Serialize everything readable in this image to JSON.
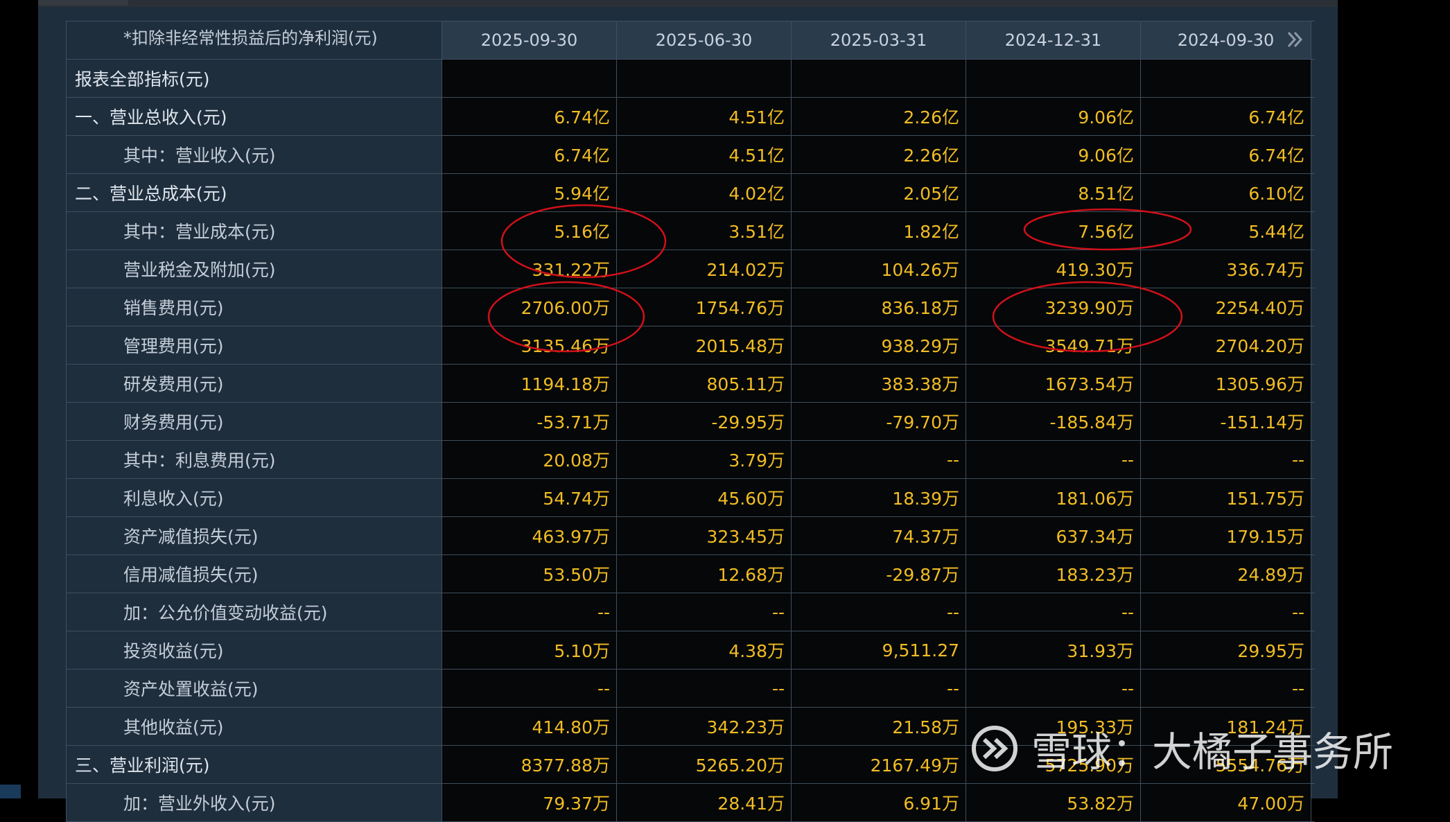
{
  "table": {
    "header_label": "*扣除非经常性损益后的净利润(元)",
    "columns": [
      "2025-09-30",
      "2025-06-30",
      "2025-03-31",
      "2024-12-31",
      "2024-09-30"
    ],
    "rows": [
      {
        "label": "报表全部指标(元)",
        "indent": false,
        "values": [
          "",
          "",
          "",
          "",
          ""
        ]
      },
      {
        "label": "一、营业总收入(元)",
        "indent": false,
        "values": [
          "6.74亿",
          "4.51亿",
          "2.26亿",
          "9.06亿",
          "6.74亿"
        ]
      },
      {
        "label": "其中：营业收入(元)",
        "indent": true,
        "values": [
          "6.74亿",
          "4.51亿",
          "2.26亿",
          "9.06亿",
          "6.74亿"
        ]
      },
      {
        "label": "二、营业总成本(元)",
        "indent": false,
        "values": [
          "5.94亿",
          "4.02亿",
          "2.05亿",
          "8.51亿",
          "6.10亿"
        ]
      },
      {
        "label": "其中：营业成本(元)",
        "indent": true,
        "values": [
          "5.16亿",
          "3.51亿",
          "1.82亿",
          "7.56亿",
          "5.44亿"
        ]
      },
      {
        "label": "营业税金及附加(元)",
        "indent": true,
        "values": [
          "331.22万",
          "214.02万",
          "104.26万",
          "419.30万",
          "336.74万"
        ]
      },
      {
        "label": "销售费用(元)",
        "indent": true,
        "values": [
          "2706.00万",
          "1754.76万",
          "836.18万",
          "3239.90万",
          "2254.40万"
        ]
      },
      {
        "label": "管理费用(元)",
        "indent": true,
        "values": [
          "3135.46万",
          "2015.48万",
          "938.29万",
          "3549.71万",
          "2704.20万"
        ]
      },
      {
        "label": "研发费用(元)",
        "indent": true,
        "values": [
          "1194.18万",
          "805.11万",
          "383.38万",
          "1673.54万",
          "1305.96万"
        ]
      },
      {
        "label": "财务费用(元)",
        "indent": true,
        "values": [
          "-53.71万",
          "-29.95万",
          "-79.70万",
          "-185.84万",
          "-151.14万"
        ]
      },
      {
        "label": "其中：利息费用(元)",
        "indent": true,
        "values": [
          "20.08万",
          "3.79万",
          "--",
          "--",
          "--"
        ]
      },
      {
        "label": "利息收入(元)",
        "indent": true,
        "values": [
          "54.74万",
          "45.60万",
          "18.39万",
          "181.06万",
          "151.75万"
        ]
      },
      {
        "label": "资产减值损失(元)",
        "indent": true,
        "values": [
          "463.97万",
          "323.45万",
          "74.37万",
          "637.34万",
          "179.15万"
        ]
      },
      {
        "label": "信用减值损失(元)",
        "indent": true,
        "values": [
          "53.50万",
          "12.68万",
          "-29.87万",
          "183.23万",
          "24.89万"
        ]
      },
      {
        "label": "加：公允价值变动收益(元)",
        "indent": true,
        "values": [
          "--",
          "--",
          "--",
          "--",
          "--"
        ]
      },
      {
        "label": "投资收益(元)",
        "indent": true,
        "values": [
          "5.10万",
          "4.38万",
          "9,511.27",
          "31.93万",
          "29.95万"
        ]
      },
      {
        "label": "资产处置收益(元)",
        "indent": true,
        "values": [
          "--",
          "--",
          "--",
          "--",
          "--"
        ]
      },
      {
        "label": "其他收益(元)",
        "indent": true,
        "values": [
          "414.80万",
          "342.23万",
          "21.58万",
          "195.33万",
          "181.24万"
        ]
      },
      {
        "label": "三、营业利润(元)",
        "indent": false,
        "values": [
          "8377.88万",
          "5265.20万",
          "2167.49万",
          "5725.90万",
          "5554.76万"
        ]
      },
      {
        "label": "加：营业外收入(元)",
        "indent": true,
        "values": [
          "79.37万",
          "28.41万",
          "6.91万",
          "53.82万",
          "47.00万"
        ]
      }
    ]
  },
  "watermark": {
    "text": "雪球：大橘子事务所"
  },
  "colors": {
    "value_text": "#f2bd23",
    "label_bg": "#1f2e3d",
    "value_bg": "#050708",
    "annotation": "#d0101a"
  },
  "icons": {
    "next_columns": "double-chevron-right-icon",
    "watermark_logo": "xueqiu-logo-icon"
  }
}
